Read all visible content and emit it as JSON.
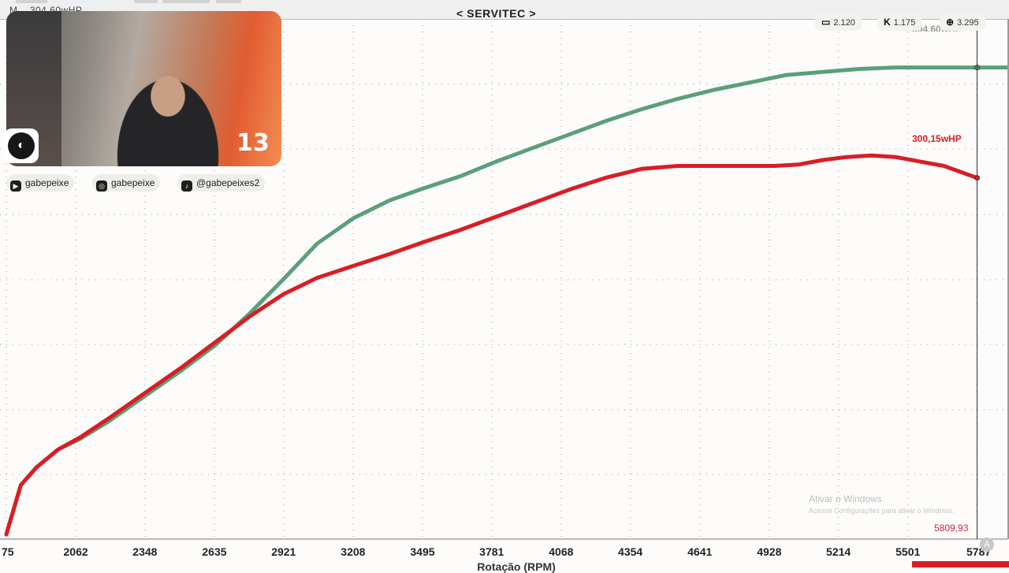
{
  "window": {
    "title": "< SERVITEC >",
    "top_left_label": "M... 304,60wHP"
  },
  "chart_data": {
    "type": "line",
    "title": "",
    "xlabel": "Rotação (RPM)",
    "ylabel": "",
    "x_tick_labels": [
      "75",
      "2062",
      "2348",
      "2635",
      "2921",
      "3208",
      "3495",
      "3781",
      "4068",
      "4354",
      "4641",
      "4928",
      "5214",
      "5501",
      "5787"
    ],
    "x_ticks": [
      1775,
      2062,
      2348,
      2635,
      2921,
      3208,
      3495,
      3781,
      4068,
      4354,
      4641,
      4928,
      5214,
      5501,
      5787
    ],
    "xlim": [
      1775,
      5920
    ],
    "ylim": [
      0,
      335
    ],
    "grid": true,
    "cursor_rpm": 5787,
    "series": [
      {
        "name": "",
        "color": "#d81e24",
        "x": [
          1775,
          1835,
          1900,
          1990,
          2080,
          2200,
          2350,
          2500,
          2640,
          2780,
          2920,
          3060,
          3210,
          3360,
          3500,
          3650,
          3800,
          3950,
          4100,
          4250,
          4400,
          4550,
          4700,
          4850,
          4950,
          5050,
          5150,
          5250,
          5350,
          5450,
          5550,
          5650,
          5787
        ],
        "y": [
          0,
          33,
          45,
          57,
          65,
          78,
          95,
          112,
          129,
          146,
          161,
          172,
          180,
          188,
          196,
          204,
          213,
          222,
          231,
          239,
          245,
          247,
          247,
          247,
          247,
          248,
          251,
          253,
          254,
          253,
          250,
          247,
          239
        ]
      },
      {
        "name": "",
        "color": "#5aa07a",
        "x": [
          1775,
          1835,
          1900,
          1990,
          2080,
          2200,
          2350,
          2500,
          2640,
          2780,
          2920,
          3060,
          3210,
          3360,
          3500,
          3650,
          3800,
          3950,
          4100,
          4250,
          4400,
          4550,
          4700,
          4850,
          5000,
          5150,
          5300,
          5450,
          5600,
          5787,
          5920
        ],
        "y": [
          0,
          33,
          45,
          57,
          64,
          76,
          93,
          110,
          127,
          148,
          171,
          195,
          212,
          224,
          232,
          240,
          250,
          259,
          268,
          277,
          285,
          292,
          298,
          303,
          308,
          310,
          312,
          313,
          313,
          313,
          313
        ]
      }
    ],
    "annotations": {
      "red_value": "300,15wHP",
      "green_value": "304,60wHP",
      "rpm_readout": "5809,93"
    }
  },
  "overlay": {
    "webcam_counter": "13",
    "socials": [
      {
        "icon": "youtube-icon",
        "glyph": "▶",
        "handle": "gabepeixe"
      },
      {
        "icon": "instagram-icon",
        "glyph": "◎",
        "handle": "gabepeixe"
      },
      {
        "icon": "tiktok-icon",
        "glyph": "♪",
        "handle": "@gabepeixes2"
      }
    ],
    "stats": [
      {
        "icon": "twitch-icon",
        "glyph": "▭",
        "value": "2.120"
      },
      {
        "icon": "kick-icon",
        "glyph": "K",
        "value": "1.175"
      },
      {
        "icon": "globe-icon",
        "glyph": "⊕",
        "value": "3.295"
      }
    ]
  },
  "watermark": {
    "title": "Ativar o Windows",
    "subtitle": "Acesse Configurações para ativar o Windows."
  }
}
